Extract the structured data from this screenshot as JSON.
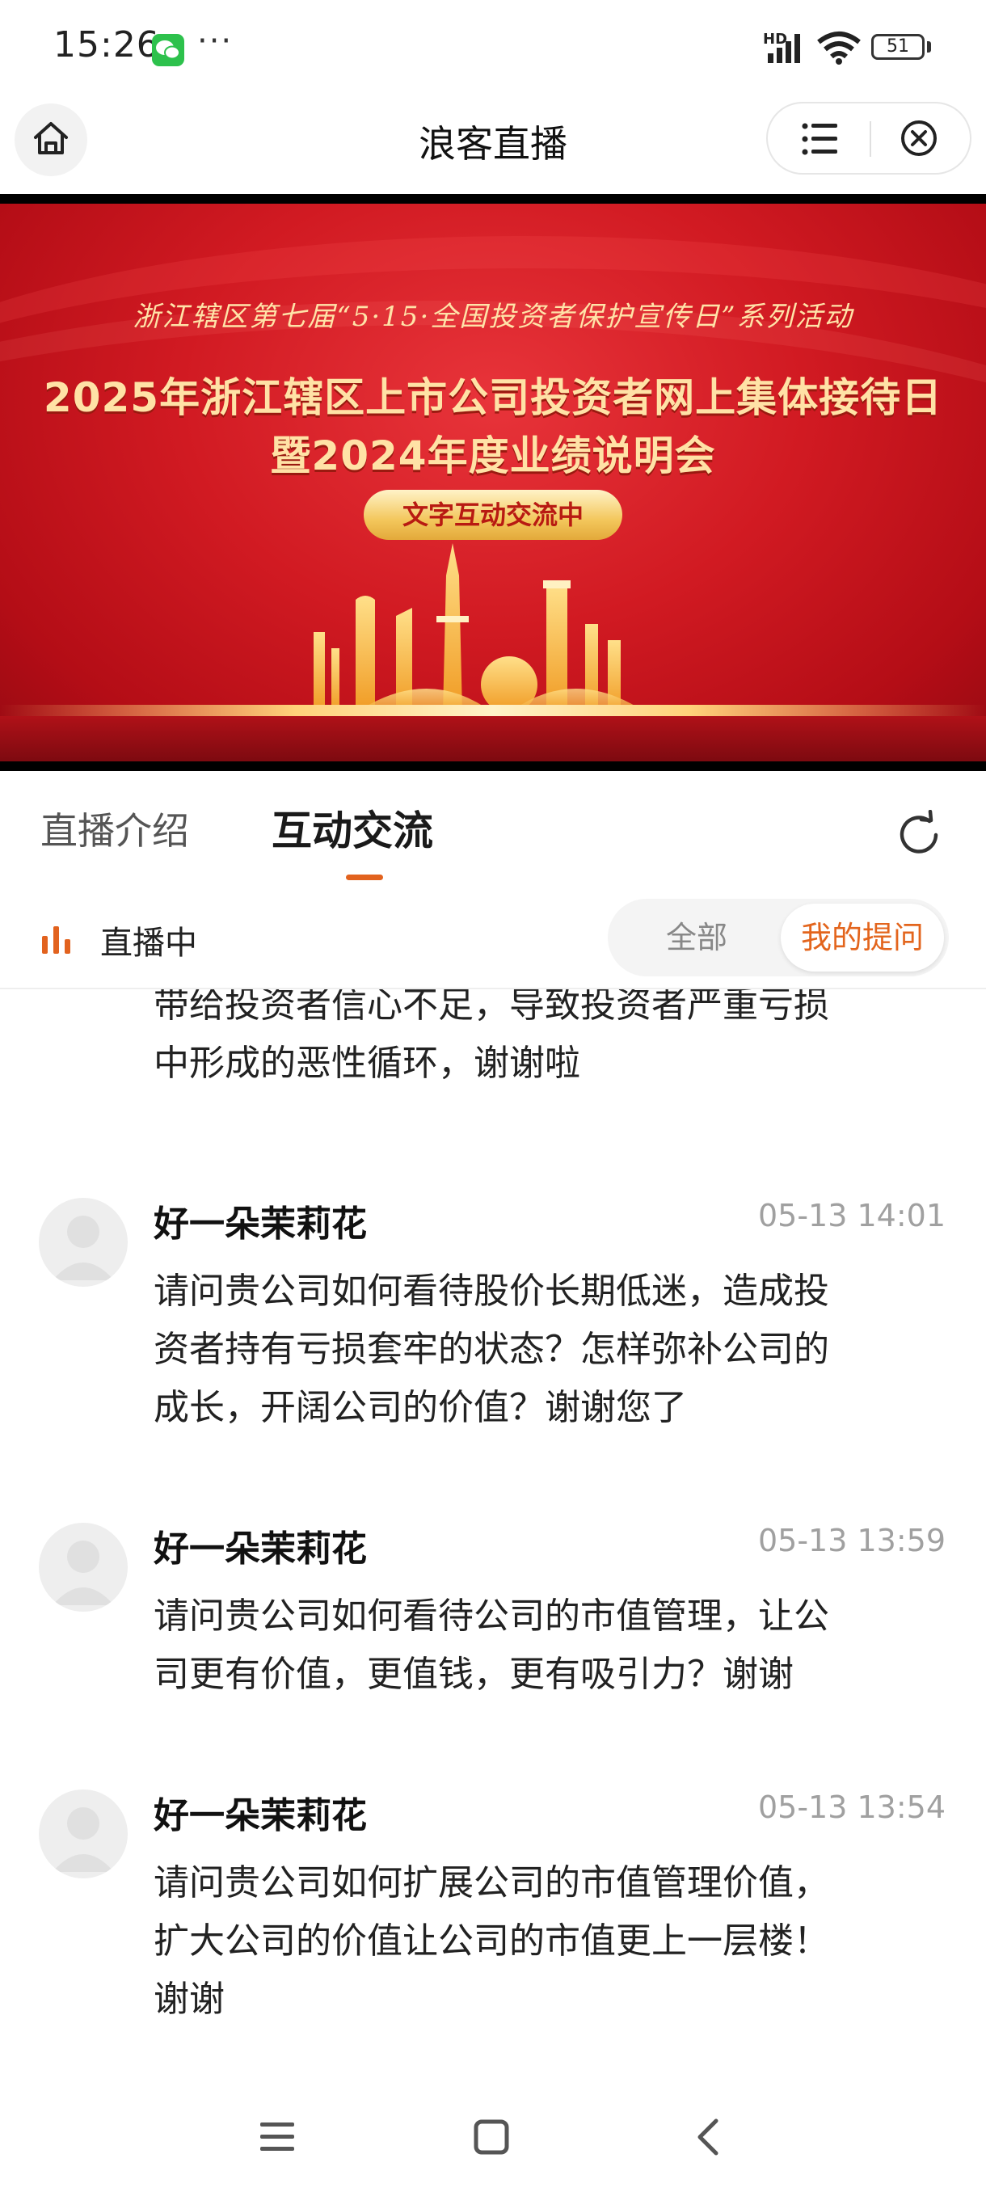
{
  "status_bar": {
    "time": "15:26",
    "overflow": "···",
    "network": "HD",
    "battery": "51"
  },
  "nav": {
    "title": "浪客直播"
  },
  "banner": {
    "subtitle": "浙江辖区第七届“5·15·全国投资者保护宣传日”系列活动",
    "title_line1": "2025年浙江辖区上市公司投资者网上集体接待日",
    "title_line2": "暨2024年度业绩说明会",
    "pill": "文字互动交流中"
  },
  "tabs": [
    {
      "label": "直播介绍",
      "active": false
    },
    {
      "label": "互动交流",
      "active": true
    }
  ],
  "filter": {
    "live_label": "直播中",
    "options": [
      "全部",
      "我的提问"
    ],
    "selected": "我的提问"
  },
  "questions": [
    {
      "partial": true,
      "lines": [
        "带给投资者信心不足，导致投资者严重亏损",
        "中形成的恶性循环，谢谢啦"
      ]
    },
    {
      "user": "好一朵茉莉花",
      "time": "05-13 14:01",
      "lines": [
        "请问贵公司如何看待股价长期低迷，造成投",
        "资者持有亏损套牢的状态？怎样弥补公司的",
        "成长，开阔公司的价值？谢谢您了"
      ]
    },
    {
      "user": "好一朵茉莉花",
      "time": "05-13 13:59",
      "lines": [
        "请问贵公司如何看待公司的市值管理，让公",
        "司更有价值，更值钱，更有吸引力？谢谢"
      ]
    },
    {
      "user": "好一朵茉莉花",
      "time": "05-13 13:54",
      "lines": [
        "请问贵公司如何扩展公司的市值管理价值，",
        "扩大公司的价值让公司的市值更上一层楼！",
        "谢谢"
      ]
    }
  ],
  "colors": {
    "accent": "#e2621e",
    "banner_red": "#d11a22",
    "gold": "#ffe2a6"
  },
  "icons": [
    "home-icon",
    "menu-icon",
    "close-circle-icon",
    "refresh-icon",
    "live-bars-icon",
    "avatar-icon",
    "nav-menu-icon",
    "nav-home-icon",
    "nav-back-icon"
  ]
}
